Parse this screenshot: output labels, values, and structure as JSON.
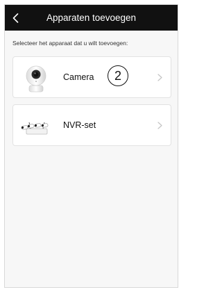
{
  "header": {
    "title": "Apparaten toevoegen",
    "back_icon": "chevron-left-icon"
  },
  "subtitle": "Selecteer het apparaat dat u wilt toevoegen:",
  "devices": [
    {
      "label": "Camera",
      "icon": "camera-icon",
      "step_badge": "2",
      "chevron_icon": "chevron-right-icon"
    },
    {
      "label": "NVR-set",
      "icon": "nvr-set-icon",
      "chevron_icon": "chevron-right-icon"
    }
  ],
  "colors": {
    "header_bg": "#111111",
    "page_bg": "#f7f7f7",
    "card_bg": "#ffffff"
  }
}
